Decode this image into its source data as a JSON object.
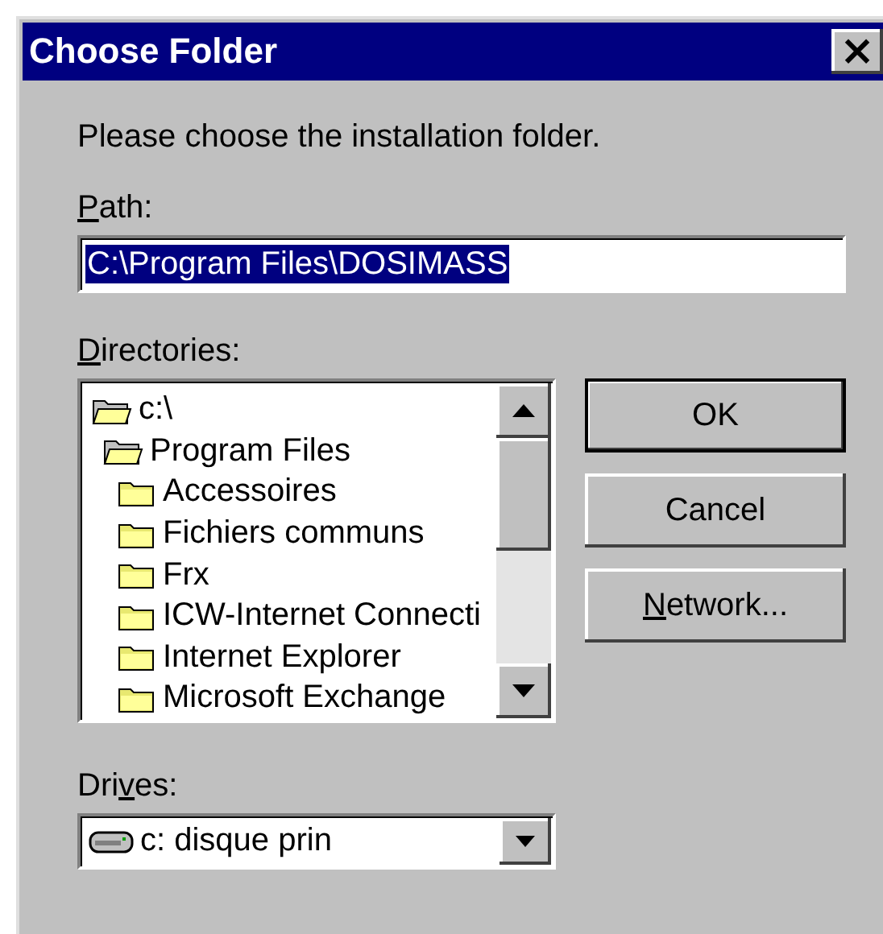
{
  "window": {
    "title": "Choose Folder",
    "close": "×"
  },
  "prompt": "Please choose the installation folder.",
  "path": {
    "label": {
      "key": "P",
      "after": "ath:"
    },
    "value": "C:\\Program Files\\DOSIMASS",
    "selected_text": true
  },
  "directories": {
    "label": {
      "key": "D",
      "after": "irectories:"
    },
    "tree": [
      {
        "name": "c:\\",
        "expanded": true,
        "children": [
          {
            "name": "Program Files",
            "expanded": true,
            "children": [
              {
                "name": "Accessoires",
                "expanded": false
              },
              {
                "name": "Fichiers communs",
                "expanded": false
              },
              {
                "name": "Frx",
                "expanded": false
              },
              {
                "name": "ICW-Internet Connecti",
                "expanded": false
              },
              {
                "name": "Internet Explorer",
                "expanded": false
              },
              {
                "name": "Microsoft Exchange",
                "expanded": false
              }
            ]
          }
        ]
      }
    ]
  },
  "buttons": [
    {
      "label": {
        "before": "OK"
      },
      "default": true
    },
    {
      "label": {
        "before": "Cancel"
      },
      "default": false
    },
    {
      "label": {
        "key": "N",
        "after": "etwork..."
      },
      "default": false
    }
  ],
  "drives": {
    "label": {
      "before": "Dri",
      "key": "v",
      "after": "es:"
    },
    "value": "c: disque prin"
  }
}
